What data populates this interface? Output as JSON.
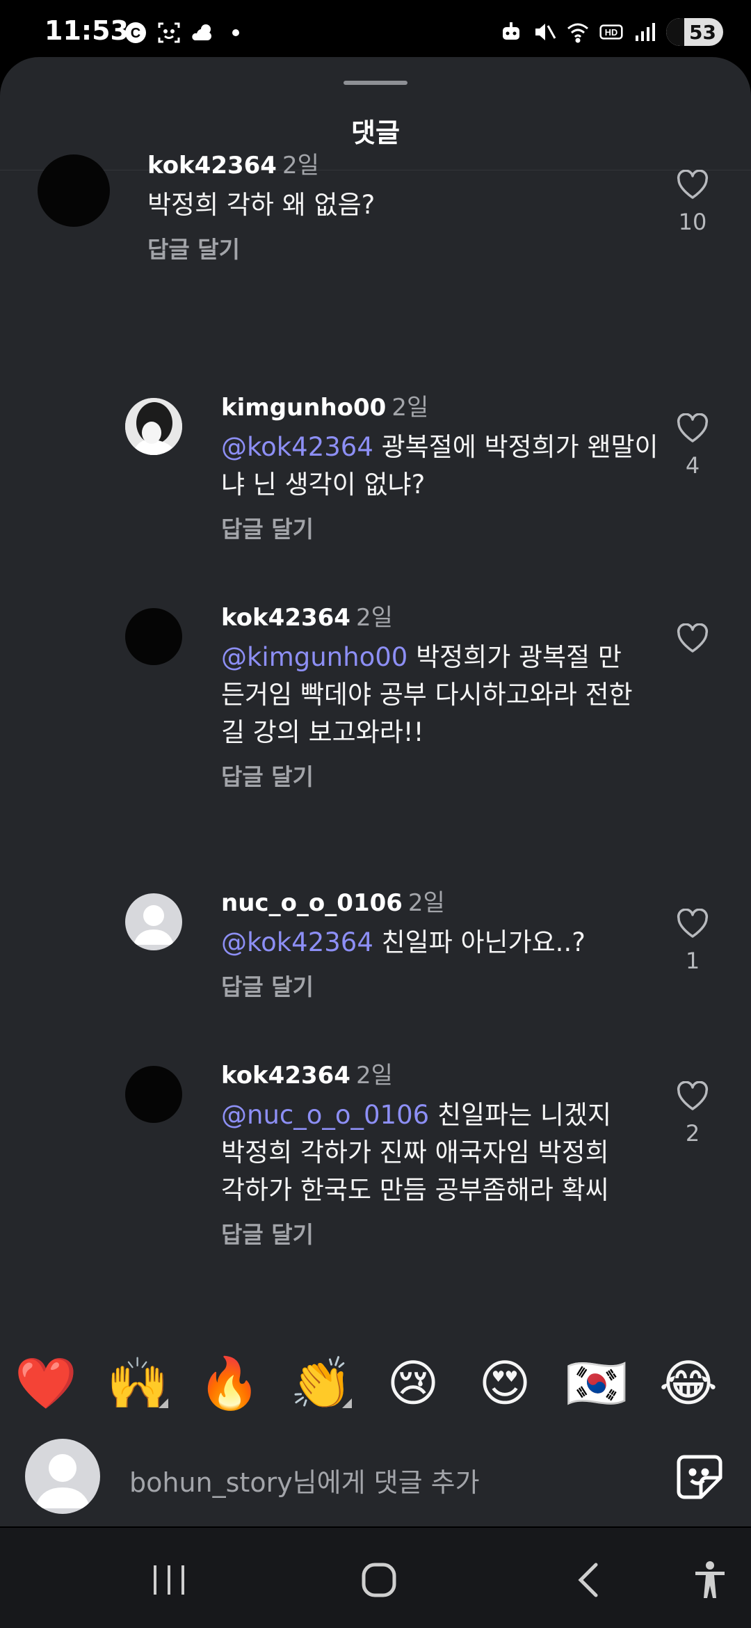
{
  "status_bar": {
    "time": "11:53",
    "battery": "53",
    "icons": [
      "c-icon",
      "face-scan-icon",
      "weather-icon",
      "dot-icon",
      "robot-icon",
      "mute-icon",
      "wifi-icon",
      "hd-icon",
      "signal-icon"
    ]
  },
  "sheet": {
    "title": "댓글"
  },
  "comments": [
    {
      "user": "kok42364",
      "time": "2일",
      "mention": "",
      "text": "박정희 각하 왜 없음?",
      "reply": "답글 달기",
      "likes": "10",
      "avatar": "black"
    },
    {
      "user": "kimgunho00",
      "time": "2일",
      "mention": "@kok42364",
      "text": " 광복절에 박정희가 왠말이냐 닌 생각이 없냐?",
      "reply": "답글 달기",
      "likes": "4",
      "avatar": "photo"
    },
    {
      "user": "kok42364",
      "time": "2일",
      "mention": "@kimgunho00",
      "text": " 박정희가 광복절 만든거임 빡데야 공부 다시하고와라 전한길 강의 보고와라!!",
      "reply": "답글 달기",
      "likes": "",
      "avatar": "black"
    },
    {
      "user": "nuc_o_o_0106",
      "time": "2일",
      "mention": "@kok42364",
      "text": " 친일파 아닌가요..?",
      "reply": "답글 달기",
      "likes": "1",
      "avatar": "default"
    },
    {
      "user": "kok42364",
      "time": "2일",
      "mention": "@nuc_o_o_0106",
      "text": " 친일파는 니겠지 박정희 각하가 진짜 애국자임 박정희 각하가 한국도 만듬 공부좀해라 확씨",
      "reply": "답글 달기",
      "likes": "2",
      "avatar": "black"
    }
  ],
  "emoji_bar": [
    "❤️",
    "🙌",
    "🔥",
    "👏",
    "😢",
    "😍",
    "🇰🇷",
    "😂"
  ],
  "input": {
    "placeholder": "bohun_story님에게 댓글 추가"
  },
  "nav": [
    "recent-apps-button",
    "home-button",
    "back-button",
    "accessibility-button"
  ]
}
